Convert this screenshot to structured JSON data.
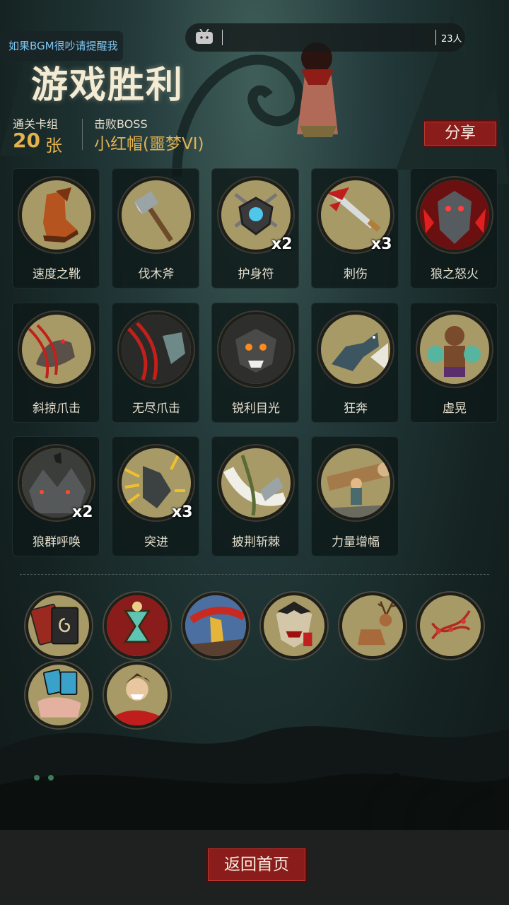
{
  "topbar": {
    "bgm_tip": "如果BGM很吵请提醒我",
    "viewer_count": "23人"
  },
  "result": {
    "title": "游戏胜利",
    "deck_label": "通关卡组",
    "deck_count": "20",
    "deck_unit": "张",
    "boss_label": "击败BOSS",
    "boss_name": "小红帽(噩梦VI)"
  },
  "share_label": "分享",
  "cards": [
    {
      "name": "速度之靴",
      "count": "",
      "icon": "boot-icon"
    },
    {
      "name": "伐木斧",
      "count": "",
      "icon": "axe-icon"
    },
    {
      "name": "护身符",
      "count": "x2",
      "icon": "amulet-icon"
    },
    {
      "name": "刺伤",
      "count": "x3",
      "icon": "dagger-icon"
    },
    {
      "name": "狼之怒火",
      "count": "",
      "icon": "wolf-rage-icon"
    },
    {
      "name": "斜掠爪击",
      "count": "",
      "icon": "claw-slash-icon"
    },
    {
      "name": "无尽爪击",
      "count": "",
      "icon": "endless-claw-icon"
    },
    {
      "name": "锐利目光",
      "count": "",
      "icon": "sharp-gaze-icon"
    },
    {
      "name": "狂奔",
      "count": "",
      "icon": "running-wolf-icon"
    },
    {
      "name": "虚晃",
      "count": "",
      "icon": "boxer-icon"
    },
    {
      "name": "狼群呼唤",
      "count": "x2",
      "icon": "wolf-pack-icon"
    },
    {
      "name": "突进",
      "count": "x3",
      "icon": "charge-icon"
    },
    {
      "name": "披荆斩棘",
      "count": "",
      "icon": "thorn-slash-icon"
    },
    {
      "name": "力量增幅",
      "count": "",
      "icon": "log-lift-icon"
    }
  ],
  "relics": [
    {
      "icon": "card-deck-icon"
    },
    {
      "icon": "hourglass-skull-icon"
    },
    {
      "icon": "golden-warrior-icon"
    },
    {
      "icon": "vampire-icon"
    },
    {
      "icon": "deer-icon"
    },
    {
      "icon": "dna-icon"
    },
    {
      "icon": "card-hand-icon"
    },
    {
      "icon": "madman-icon"
    }
  ],
  "home_label": "返回首页",
  "colors": {
    "accent_gold": "#e3b24f",
    "button_red": "#8a1d1b",
    "tip_blue": "#7cc6f0",
    "card_bg": "#a79a66"
  }
}
